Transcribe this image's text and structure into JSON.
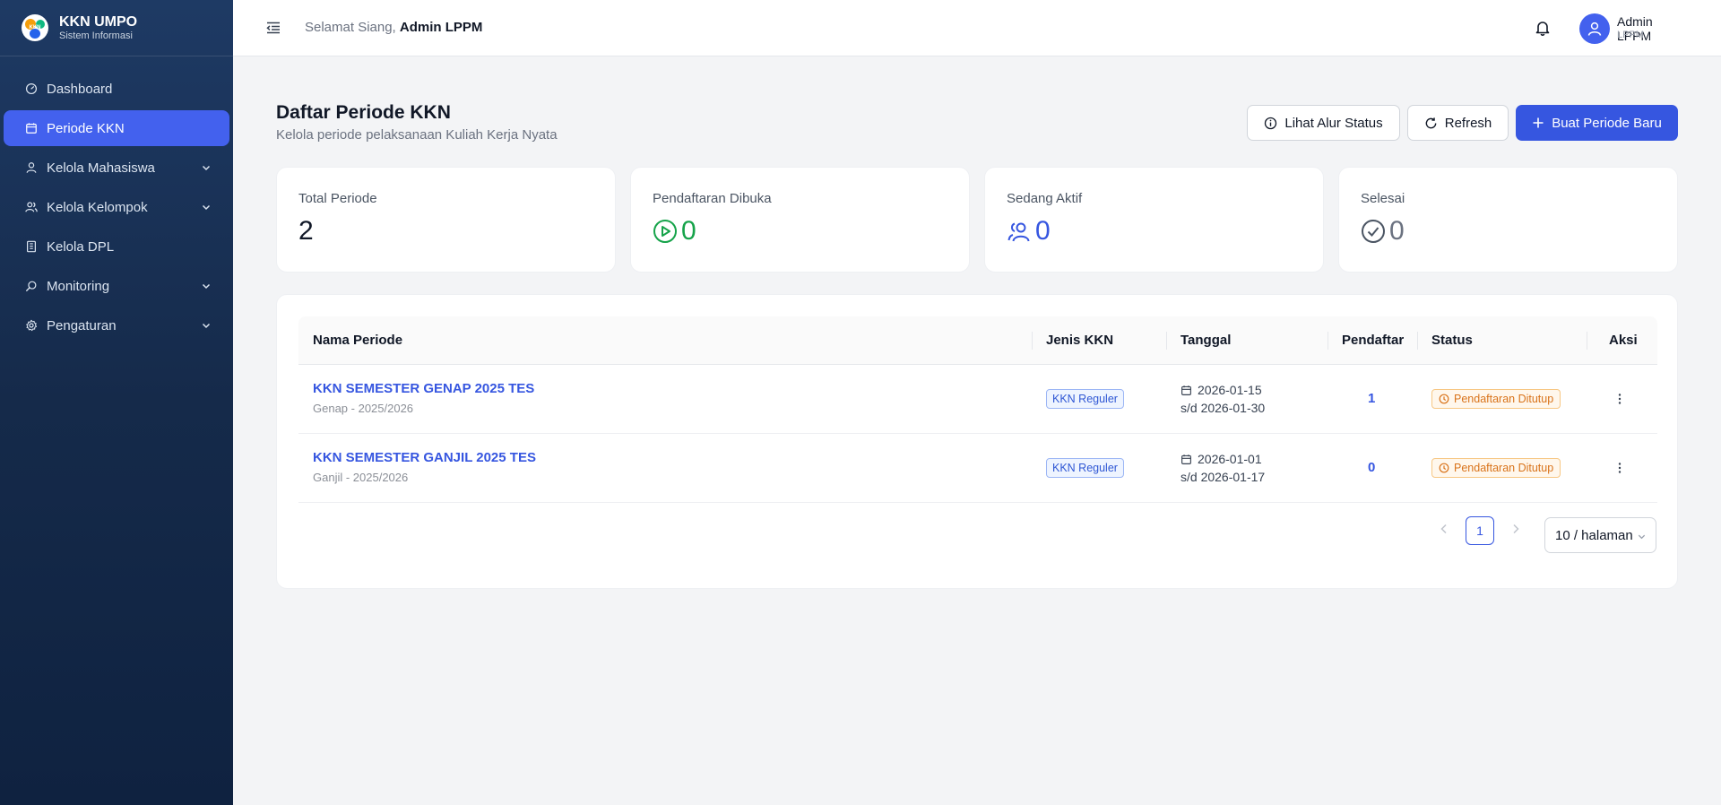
{
  "sidebar": {
    "brand_title": "KKN UMPO",
    "brand_sub": "Sistem Informasi",
    "logo_text": "KKN",
    "items": [
      {
        "label": "Dashboard",
        "icon": "dashboard-icon",
        "active": false,
        "expandable": false
      },
      {
        "label": "Periode KKN",
        "icon": "calendar-icon",
        "active": true,
        "expandable": false
      },
      {
        "label": "Kelola Mahasiswa",
        "icon": "user-icon",
        "active": false,
        "expandable": true
      },
      {
        "label": "Kelola Kelompok",
        "icon": "users-icon",
        "active": false,
        "expandable": true
      },
      {
        "label": "Kelola DPL",
        "icon": "building-icon",
        "active": false,
        "expandable": false
      },
      {
        "label": "Monitoring",
        "icon": "search-icon",
        "active": false,
        "expandable": true
      },
      {
        "label": "Pengaturan",
        "icon": "gear-icon",
        "active": false,
        "expandable": true
      }
    ]
  },
  "header": {
    "greeting_prefix": "Selamat Siang,",
    "greeting_name": "Admin LPPM",
    "user_name": "Admin LPPM",
    "user_role": "LPPM"
  },
  "page": {
    "title": "Daftar Periode KKN",
    "subtitle": "Kelola periode pelaksanaan Kuliah Kerja Nyata",
    "btn_alur": "Lihat Alur Status",
    "btn_refresh": "Refresh",
    "btn_new": "Buat Periode Baru"
  },
  "stats": [
    {
      "label": "Total Periode",
      "value": "2",
      "color": "#111827"
    },
    {
      "label": "Pendaftaran Dibuka",
      "value": "0",
      "color": "#16a34a"
    },
    {
      "label": "Sedang Aktif",
      "value": "0",
      "color": "#3656e0"
    },
    {
      "label": "Selesai",
      "value": "0",
      "color": "#6b7280"
    }
  ],
  "table": {
    "columns": [
      "Nama Periode",
      "Jenis KKN",
      "Tanggal",
      "Pendaftar",
      "Status",
      "Aksi"
    ],
    "rows": [
      {
        "name": "KKN SEMESTER GENAP 2025 TES",
        "sub": "Genap - 2025/2026",
        "jenis": "KKN Reguler",
        "start": "2026-01-15",
        "end": "s/d 2026-01-30",
        "pendaftar": "1",
        "status": "Pendaftaran Ditutup"
      },
      {
        "name": "KKN SEMESTER GANJIL 2025 TES",
        "sub": "Ganjil - 2025/2026",
        "jenis": "KKN Reguler",
        "start": "2026-01-01",
        "end": "s/d 2026-01-17",
        "pendaftar": "0",
        "status": "Pendaftaran Ditutup"
      }
    ]
  },
  "pagination": {
    "current": "1",
    "page_size": "10 / halaman"
  },
  "colors": {
    "primary": "#3656e0",
    "sidebar": "#1e3a64",
    "success": "#16a34a",
    "warning": "#d9731a"
  }
}
